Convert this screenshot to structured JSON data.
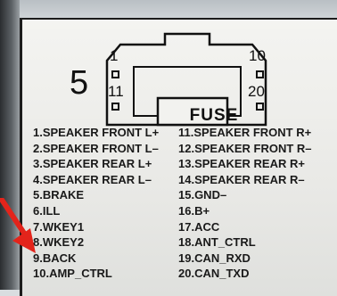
{
  "connector": {
    "side_number": "5",
    "pin_marks": [
      "1",
      "10",
      "11",
      "20"
    ],
    "fuse_label": "FUSE"
  },
  "pins": {
    "left": [
      "1.SPEAKER FRONT L+",
      "2.SPEAKER FRONT L–",
      "3.SPEAKER REAR L+",
      "4.SPEAKER REAR L–",
      "5.BRAKE",
      "6.ILL",
      "7.WKEY1",
      "8.WKEY2",
      "9.BACK",
      "10.AMP_CTRL"
    ],
    "right": [
      "11.SPEAKER FRONT R+",
      "12.SPEAKER FRONT R–",
      "13.SPEAKER REAR R+",
      "14.SPEAKER REAR R–",
      "15.GND–",
      "16.B+",
      "17.ACC",
      "18.ANT_CTRL",
      "19.CAN_RXD",
      "20.CAN_TXD"
    ]
  },
  "colors": {
    "arrow": "#e3241b",
    "label_bg": "#efefec",
    "ink": "#1a1a1a"
  }
}
